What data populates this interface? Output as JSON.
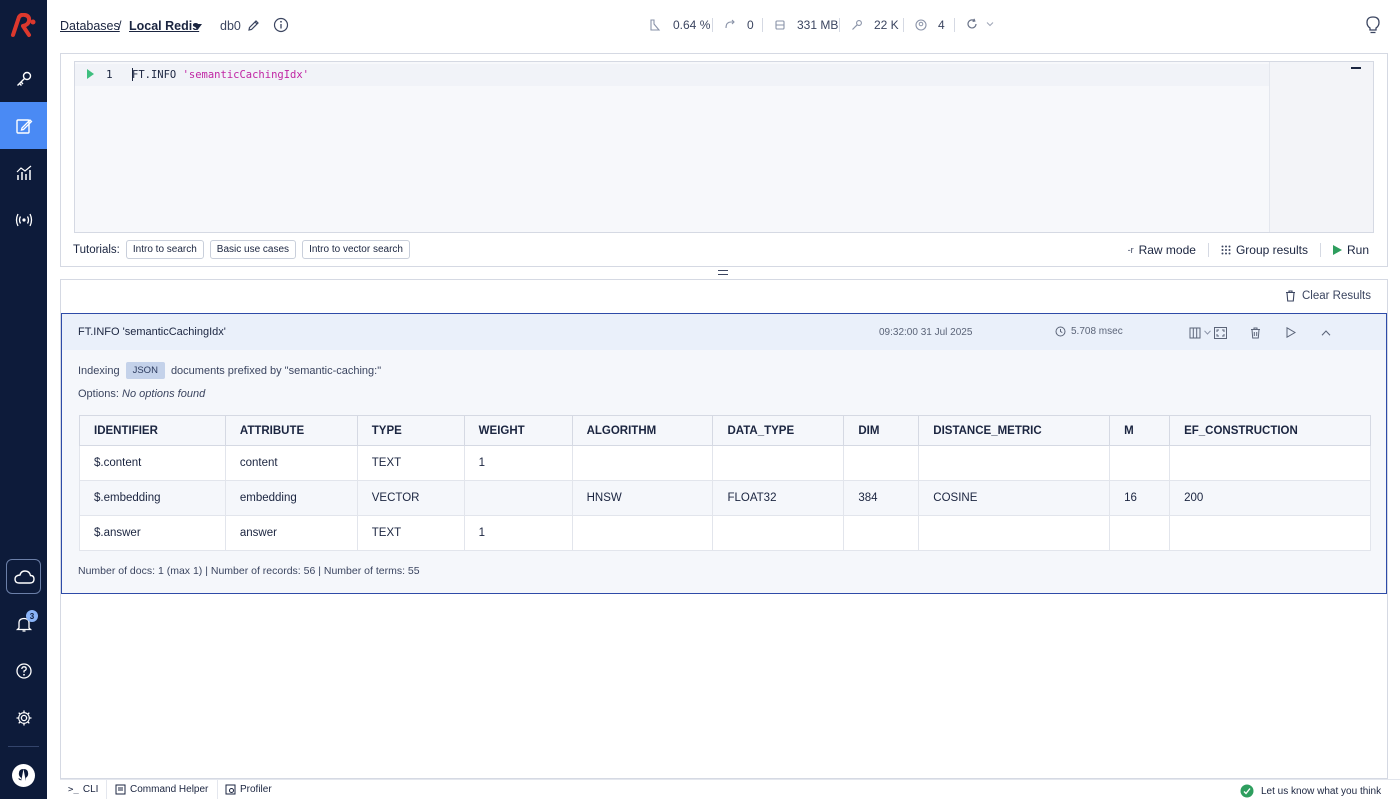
{
  "header": {
    "breadcrumb_root": "Databases",
    "breadcrumb_sep": "/",
    "database_name": "Local Redis",
    "db_index": "db0",
    "stats": {
      "cpu": "0.64 %",
      "ops": "0",
      "memory": "331 MB",
      "keys": "22 K",
      "clients": "4"
    }
  },
  "editor": {
    "line_number": "1",
    "code_cmd": "FT.INFO ",
    "code_arg": "'semanticCachingIdx'",
    "tutorials_label": "Tutorials:",
    "tutorials": [
      "Intro to search",
      "Basic use cases",
      "Intro to vector search"
    ],
    "raw_mode_prefix": "-r",
    "raw_mode_label": "Raw mode",
    "group_results_label": "Group results",
    "run_label": "Run"
  },
  "results": {
    "clear_label": "Clear Results",
    "card": {
      "command": "FT.INFO 'semanticCachingIdx'",
      "timestamp": "09:32:00 31 Jul 2025",
      "duration": "5.708 msec",
      "indexing_label": "Indexing",
      "indexing_type": "JSON",
      "indexing_suffix": "documents prefixed by \"semantic-caching:\"",
      "options_label": "Options:",
      "options_value": "No options found",
      "table": {
        "headers": [
          "IDENTIFIER",
          "ATTRIBUTE",
          "TYPE",
          "WEIGHT",
          "ALGORITHM",
          "DATA_TYPE",
          "DIM",
          "DISTANCE_METRIC",
          "M",
          "EF_CONSTRUCTION"
        ],
        "rows": [
          [
            "$.content",
            "content",
            "TEXT",
            "1",
            "",
            "",
            "",
            "",
            "",
            ""
          ],
          [
            "$.embedding",
            "embedding",
            "VECTOR",
            "",
            "HNSW",
            "FLOAT32",
            "384",
            "COSINE",
            "16",
            "200"
          ],
          [
            "$.answer",
            "answer",
            "TEXT",
            "1",
            "",
            "",
            "",
            "",
            "",
            ""
          ]
        ]
      },
      "summary": "Number of docs: 1 (max 1) | Number of records: 56 | Number of terms: 55"
    }
  },
  "sidebar": {
    "notification_count": "3"
  },
  "bottombar": {
    "cli": "CLI",
    "cli_prefix": ">_",
    "command_helper": "Command Helper",
    "profiler": "Profiler",
    "feedback": "Let us know what you think"
  },
  "colors": {
    "sidebar_bg": "#0d1b3a",
    "active_item": "#4a8af4",
    "brand_red": "#dc382d",
    "run_green": "#3fbf7f",
    "card_border": "#2e4ba8"
  }
}
